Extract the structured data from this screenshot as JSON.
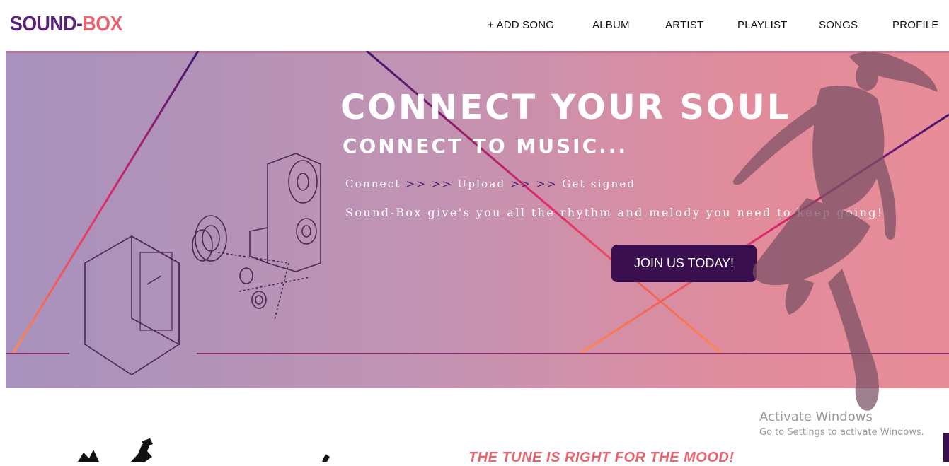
{
  "brand": {
    "part1": "SOUND-",
    "part2": "BOX"
  },
  "nav": [
    {
      "label": "+ ADD SONG"
    },
    {
      "label": "ALBUM"
    },
    {
      "label": "ARTIST"
    },
    {
      "label": "PLAYLIST"
    },
    {
      "label": "SONGS"
    },
    {
      "label": "PROFILE"
    }
  ],
  "hero": {
    "headline": "CONNECT YOUR SOUL",
    "subheadline": "CONNECT TO MUSIC...",
    "steps": {
      "step1": "Connect",
      "sep1": ">> >>",
      "step2": "Upload",
      "sep2": ">> >>",
      "step3": "Get signed"
    },
    "tagline": "Sound-Box give's you all the rhythm and melody you need to keep going!",
    "cta_label": "JOIN US TODAY!"
  },
  "section": {
    "title": "THE TUNE IS RIGHT FOR THE MOOD!"
  },
  "watermark": {
    "title": "Activate Windows",
    "subtitle": "Go to Settings to activate Windows."
  },
  "colors": {
    "brand_purple": "#5b1e7a",
    "brand_coral": "#e8636d",
    "cta_bg": "#3a0f4f"
  }
}
